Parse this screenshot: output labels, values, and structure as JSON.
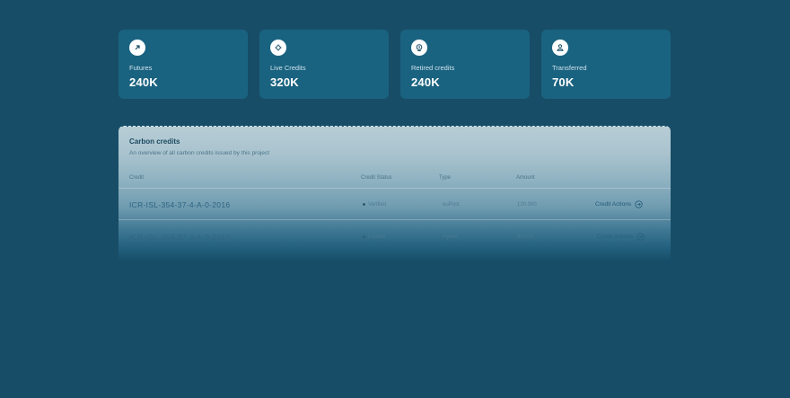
{
  "stats": [
    {
      "label": "Futures",
      "value": "240K",
      "icon": "arrow-up-right-icon"
    },
    {
      "label": "Live Credits",
      "value": "320K",
      "icon": "leaf-spark-icon"
    },
    {
      "label": "Retired credits",
      "value": "240K",
      "icon": "retired-badge-icon"
    },
    {
      "label": "Transferred",
      "value": "70K",
      "icon": "transfer-person-icon"
    }
  ],
  "table": {
    "title": "Carbon credits",
    "subtitle": "An overview of all carbon credits issued by this project",
    "columns": [
      "Credit",
      "Credit Status",
      "Type",
      "Amount"
    ],
    "rows": [
      {
        "credit": "ICR-ISL-354-37-4-A-0-2016",
        "status": "Verified",
        "type": "euPost",
        "amount": "120.000",
        "action": "Credit Actions"
      },
      {
        "credit": "ICR-ISL-354-37-4-A-0-2017",
        "status": "Locked",
        "type": "Hybrid",
        "amount": "80.000",
        "action": "Credit Actions"
      }
    ]
  },
  "colors": {
    "background": "#174d66",
    "card": "#1a6380",
    "accent": "#ffffff"
  }
}
